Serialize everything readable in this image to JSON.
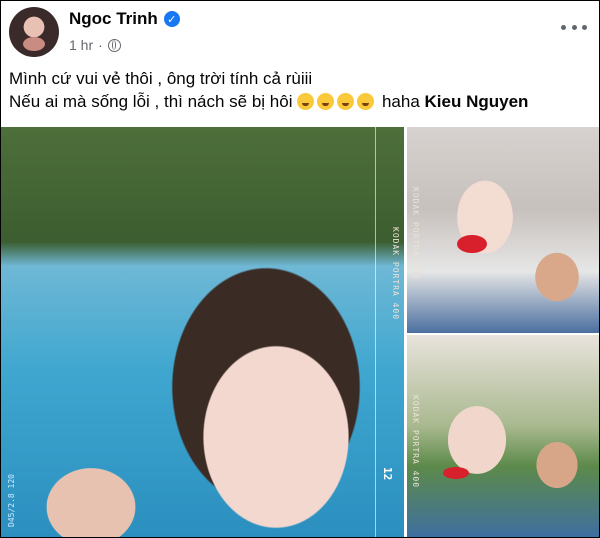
{
  "post": {
    "author": "Ngoc Trinh",
    "verified_glyph": "✓",
    "time": "1 hr",
    "dot": "·",
    "audience_icon": "globe-icon",
    "more_icon": "more-options-icon",
    "text_line1": "Mình cứ vui vẻ thôi , ông trời tính cả rùiii",
    "text_line2": "Nếu ai mà sống lỗi , thì nách sẽ bị hôi",
    "emojis": [
      "rolling-laughing-emoji",
      "laughing-emoji",
      "smiling-emoji",
      "grinning-sweat-emoji"
    ],
    "text_suffix": "haha",
    "tag": "Kieu Nguyen"
  },
  "photos": {
    "main": {
      "film_text": "KODAK PORTRA 400",
      "film_number": "12",
      "frame_text": "D45/2.8 120"
    },
    "top_right": {
      "film_text": "KODAK PORTRA 400"
    },
    "bottom_right": {
      "film_text": "KODAK PORTRA 400"
    }
  },
  "colors": {
    "verified": "#1877f2",
    "meta": "#65676b",
    "text": "#050505"
  }
}
